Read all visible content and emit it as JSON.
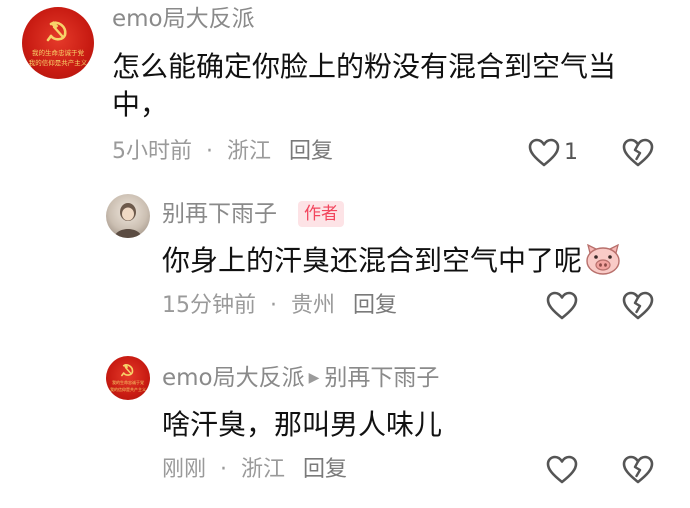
{
  "comments": [
    {
      "username": "emo局大反派",
      "avatar_caption": [
        "我的生命忠诚于党",
        "我的信仰是共产主义"
      ],
      "text": "怎么能确定你脸上的粉没有混合到空气当中，",
      "time": "5小时前",
      "location": "浙江",
      "reply_label": "回复",
      "like_count": "1"
    },
    {
      "username": "别再下雨子",
      "badge": "作者",
      "text": "你身上的汗臭还混合到空气中了呢",
      "emoji": "pig-face-emoji",
      "time": "15分钟前",
      "location": "贵州",
      "reply_label": "回复"
    },
    {
      "username": "emo局大反派",
      "reply_to": "别再下雨子",
      "avatar_caption": [
        "我的生命忠诚于党",
        "我的信仰是共产主义"
      ],
      "text": "啥汗臭，那叫男人味儿",
      "time": "刚刚",
      "location": "浙江",
      "reply_label": "回复"
    }
  ],
  "colors": {
    "avatar_red": "#c81b12",
    "emblem_gold": "#f7d36a",
    "author_badge_bg": "#fde3e6",
    "author_badge_text": "#f2455d",
    "meta_gray": "#9a9a9a"
  },
  "icons": {
    "like": "heart-outline-icon",
    "dislike": "broken-heart-icon"
  }
}
